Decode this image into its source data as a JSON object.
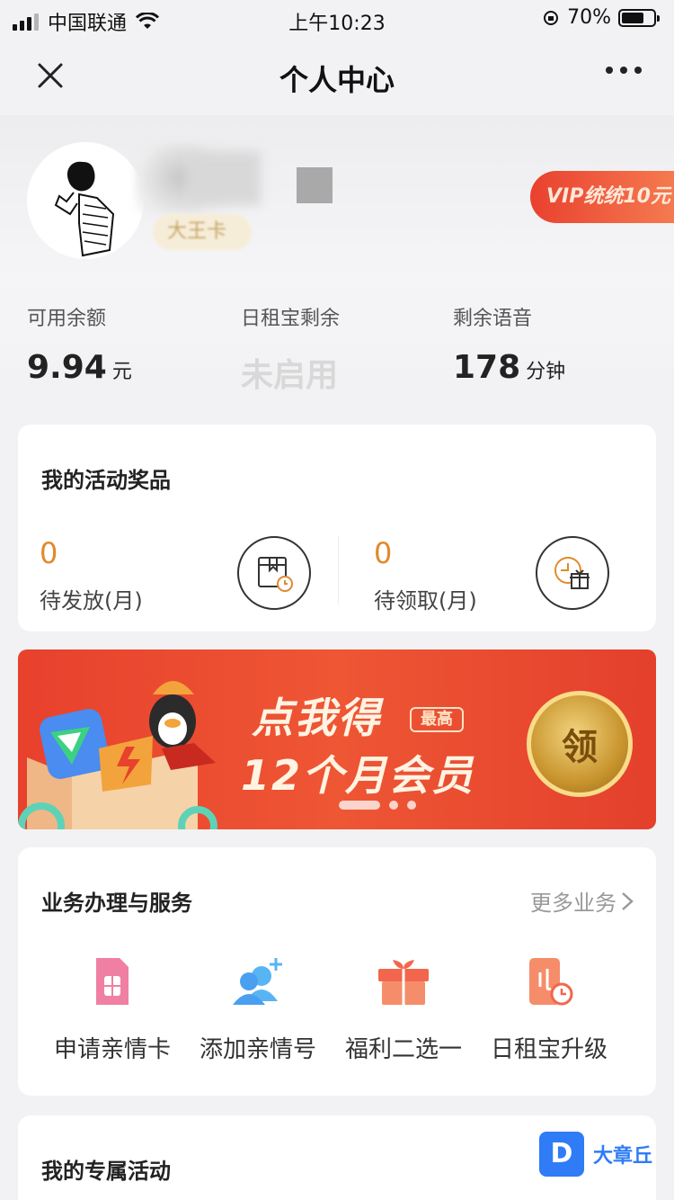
{
  "status_bar": {
    "carrier": "中国联通",
    "time": "上午10:23",
    "battery": "70%"
  },
  "nav": {
    "title": "个人中心"
  },
  "profile": {
    "member_badge": "大王卡",
    "vip_tag": "VIP统统10元"
  },
  "stats": [
    {
      "label": "可用余额",
      "value": "9.94",
      "unit": "元"
    },
    {
      "label": "日租宝剩余",
      "value": "未启用",
      "unit": ""
    },
    {
      "label": "剩余语音",
      "value": "178",
      "unit": "分钟"
    }
  ],
  "prizes": {
    "title": "我的活动奖品",
    "items": [
      {
        "count": "0",
        "label": "待发放(月)"
      },
      {
        "count": "0",
        "label": "待领取(月)"
      }
    ]
  },
  "banner": {
    "line1": "点我得",
    "badge": "最高",
    "line2": "12个月会员",
    "cta": "领"
  },
  "services": {
    "title": "业务办理与服务",
    "more": "更多业务",
    "items": [
      {
        "label": "申请亲情卡",
        "icon": "sim-card-icon"
      },
      {
        "label": "添加亲情号",
        "icon": "add-contact-icon"
      },
      {
        "label": "福利二选一",
        "icon": "gift-box-icon"
      },
      {
        "label": "日租宝升级",
        "icon": "phone-clock-icon"
      }
    ]
  },
  "exclusive": {
    "title": "我的专属活动"
  },
  "watermark": {
    "logo": "D",
    "text": "大章丘"
  }
}
